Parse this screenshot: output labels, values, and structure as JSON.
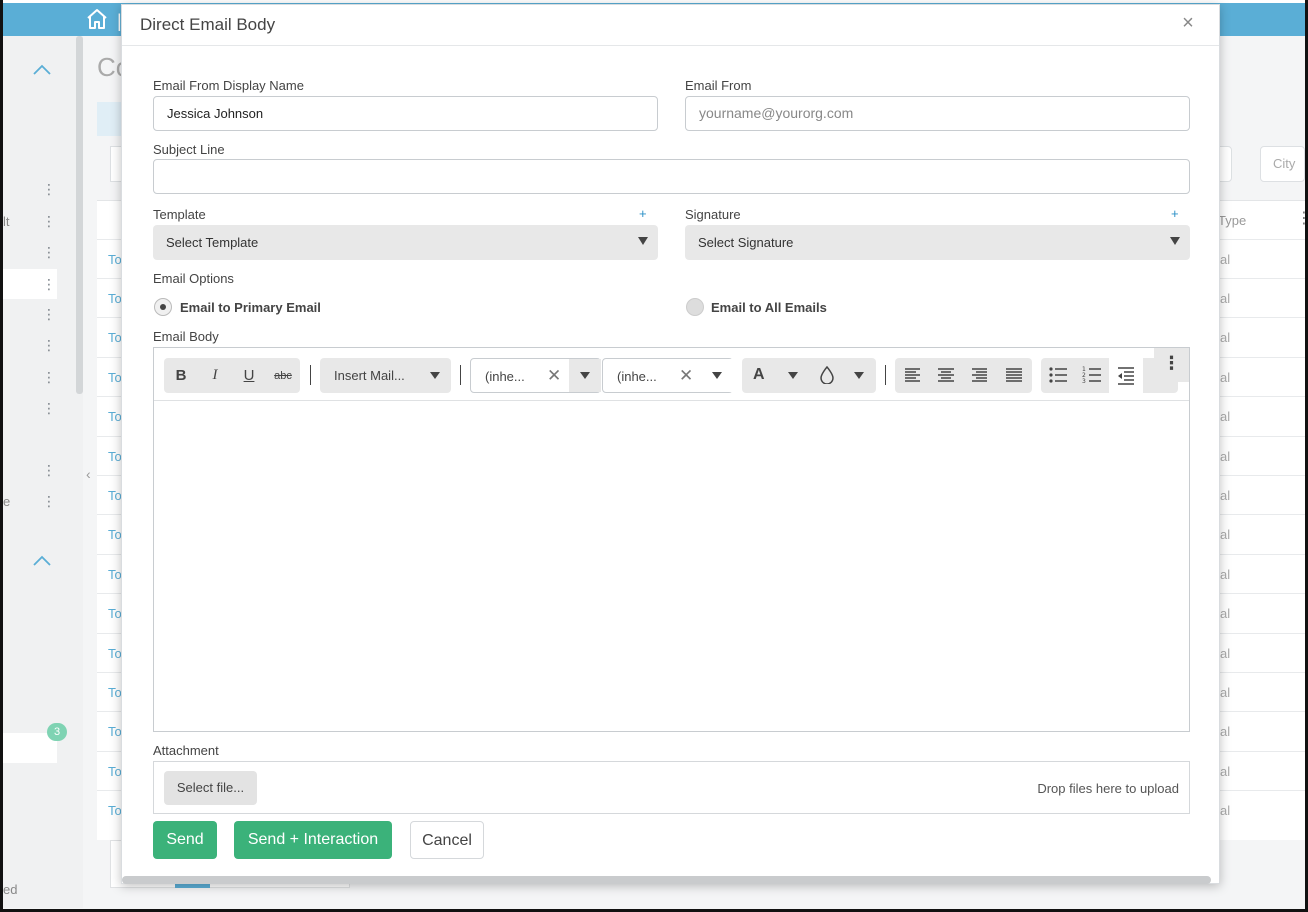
{
  "background": {
    "page_title_partial": "Co",
    "city_placeholder": "City",
    "type_column": "Type",
    "row_link_text": "To",
    "row_type_text": "al",
    "left_text_a": "lt",
    "left_text_b": "e",
    "left_text_bottom": "ed",
    "notification_count": "3"
  },
  "modal": {
    "title": "Direct Email Body",
    "close_glyph": "×",
    "from_name_label": "Email From Display Name",
    "from_name_value": "Jessica Johnson",
    "email_from_label": "Email From",
    "email_from_placeholder": "yourname@yourorg.com",
    "subject_label": "Subject Line",
    "subject_value": "",
    "template_label": "Template",
    "template_add": "+",
    "template_select": "Select Template",
    "signature_label": "Signature",
    "signature_add": "+",
    "signature_select": "Select Signature",
    "email_options_label": "Email Options",
    "option_primary": "Email to Primary Email",
    "option_all": "Email to All Emails",
    "selected_option": "primary",
    "body_label": "Email Body",
    "toolbar": {
      "bold": "B",
      "italic": "I",
      "underline": "U",
      "strike": "abc",
      "insert_mail": "Insert Mail...",
      "font_family": "(inhe...",
      "font_size": "(inhe...",
      "font_color": "A"
    },
    "attachment_label": "Attachment",
    "select_file": "Select file...",
    "drop_text": "Drop files here to upload",
    "send": "Send",
    "send_interaction": "Send + Interaction",
    "cancel": "Cancel"
  },
  "colors": {
    "topbar": "#5aaed6",
    "primary_button": "#3bb27a",
    "link": "#5aaed6",
    "badge": "#7fd3b3"
  }
}
